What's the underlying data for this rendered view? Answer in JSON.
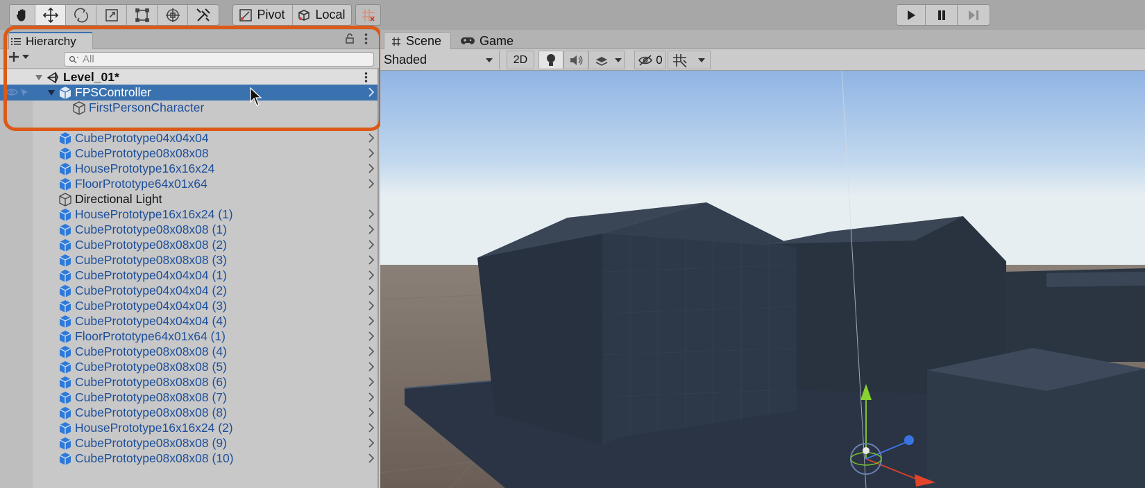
{
  "toolbar": {
    "tools": [
      "hand-tool",
      "move-tool",
      "rotate-tool",
      "scale-tool",
      "rect-tool",
      "transform-tool",
      "custom-tool"
    ],
    "pivot_label": "Pivot",
    "local_label": "Local"
  },
  "hierarchy": {
    "tab_label": "Hierarchy",
    "search_placeholder": "All",
    "scene_name": "Level_01*",
    "selected": "FPSController",
    "child": "FirstPersonCharacter",
    "items": [
      {
        "label": "CubePrototype04x04x04",
        "type": "prefab"
      },
      {
        "label": "CubePrototype08x08x08",
        "type": "prefab"
      },
      {
        "label": "HousePrototype16x16x24",
        "type": "prefab"
      },
      {
        "label": "FloorPrototype64x01x64",
        "type": "prefab"
      },
      {
        "label": "Directional Light",
        "type": "object"
      },
      {
        "label": "HousePrototype16x16x24 (1)",
        "type": "prefab"
      },
      {
        "label": "CubePrototype08x08x08 (1)",
        "type": "prefab"
      },
      {
        "label": "CubePrototype08x08x08 (2)",
        "type": "prefab"
      },
      {
        "label": "CubePrototype08x08x08 (3)",
        "type": "prefab"
      },
      {
        "label": "CubePrototype04x04x04 (1)",
        "type": "prefab"
      },
      {
        "label": "CubePrototype04x04x04 (2)",
        "type": "prefab"
      },
      {
        "label": "CubePrototype04x04x04 (3)",
        "type": "prefab"
      },
      {
        "label": "CubePrototype04x04x04 (4)",
        "type": "prefab"
      },
      {
        "label": "FloorPrototype64x01x64 (1)",
        "type": "prefab"
      },
      {
        "label": "CubePrototype08x08x08 (4)",
        "type": "prefab"
      },
      {
        "label": "CubePrototype08x08x08 (5)",
        "type": "prefab"
      },
      {
        "label": "CubePrototype08x08x08 (6)",
        "type": "prefab"
      },
      {
        "label": "CubePrototype08x08x08 (7)",
        "type": "prefab"
      },
      {
        "label": "CubePrototype08x08x08 (8)",
        "type": "prefab"
      },
      {
        "label": "HousePrototype16x16x24 (2)",
        "type": "prefab"
      },
      {
        "label": "CubePrototype08x08x08 (9)",
        "type": "prefab"
      },
      {
        "label": "CubePrototype08x08x08 (10)",
        "type": "prefab"
      }
    ]
  },
  "scene": {
    "tab_scene": "Scene",
    "tab_game": "Game",
    "shading_mode": "Shaded",
    "mode_2d": "2D",
    "hidden_count": "0"
  },
  "colors": {
    "selection": "#3a72b0",
    "prefab_text": "#1d4f9a",
    "highlight_border": "#dc5a18"
  }
}
